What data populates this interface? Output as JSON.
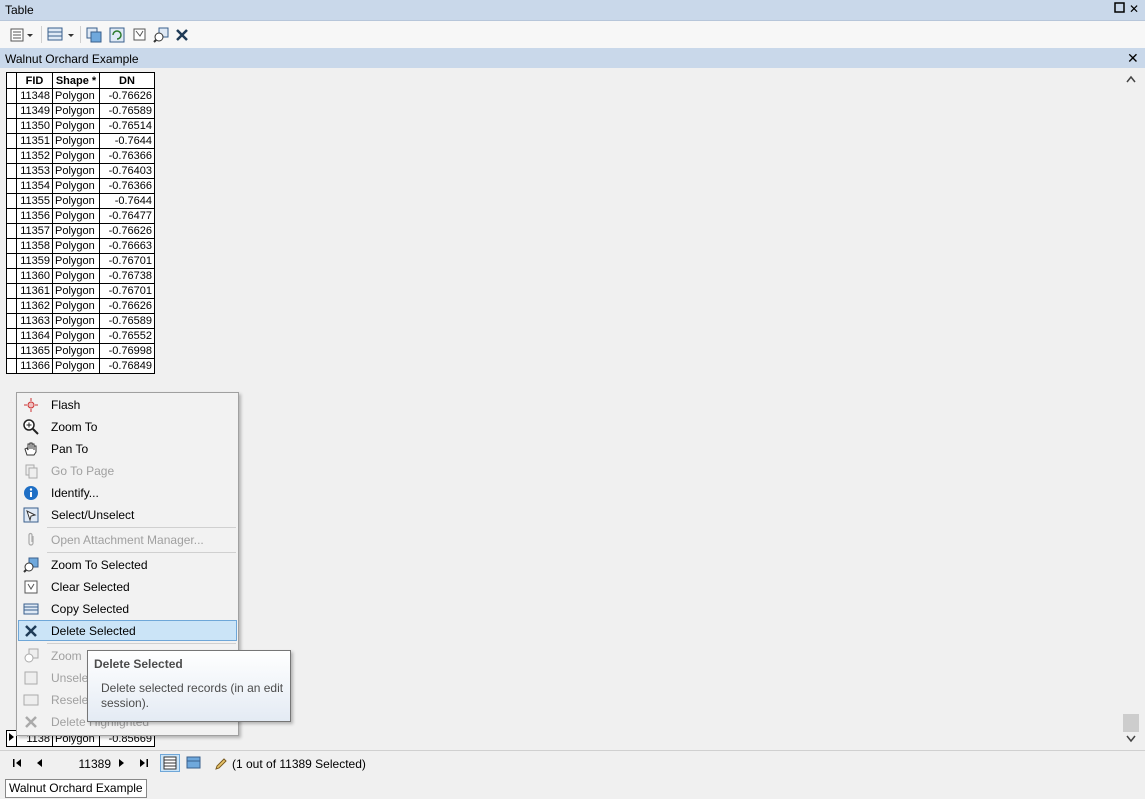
{
  "window": {
    "title": "Table"
  },
  "table_tab": {
    "title": "Walnut Orchard Example"
  },
  "grid": {
    "headers": [
      "FID",
      "Shape *",
      "DN"
    ],
    "rows": [
      [
        "11348",
        "Polygon",
        "-0.76626"
      ],
      [
        "11349",
        "Polygon",
        "-0.76589"
      ],
      [
        "11350",
        "Polygon",
        "-0.76514"
      ],
      [
        "11351",
        "Polygon",
        "-0.7644"
      ],
      [
        "11352",
        "Polygon",
        "-0.76366"
      ],
      [
        "11353",
        "Polygon",
        "-0.76403"
      ],
      [
        "11354",
        "Polygon",
        "-0.76366"
      ],
      [
        "11355",
        "Polygon",
        "-0.7644"
      ],
      [
        "11356",
        "Polygon",
        "-0.76477"
      ],
      [
        "11357",
        "Polygon",
        "-0.76626"
      ],
      [
        "11358",
        "Polygon",
        "-0.76663"
      ],
      [
        "11359",
        "Polygon",
        "-0.76701"
      ],
      [
        "11360",
        "Polygon",
        "-0.76738"
      ],
      [
        "11361",
        "Polygon",
        "-0.76701"
      ],
      [
        "11362",
        "Polygon",
        "-0.76626"
      ],
      [
        "11363",
        "Polygon",
        "-0.76589"
      ],
      [
        "11364",
        "Polygon",
        "-0.76552"
      ],
      [
        "11365",
        "Polygon",
        "-0.76998"
      ],
      [
        "11366",
        "Polygon",
        "-0.76849"
      ]
    ],
    "selected_row": [
      "1138",
      "Polygon",
      "-0.85669"
    ]
  },
  "context_menu": {
    "items": [
      {
        "label": "Flash",
        "icon": "flash-icon",
        "enabled": true
      },
      {
        "label": "Zoom To",
        "icon": "zoom-in-icon",
        "enabled": true
      },
      {
        "label": "Pan To",
        "icon": "hand-icon",
        "enabled": true
      },
      {
        "label": "Go To Page",
        "icon": "page-icon",
        "enabled": false
      },
      {
        "label": "Identify...",
        "icon": "info-icon",
        "enabled": true
      },
      {
        "label": "Select/Unselect",
        "icon": "select-icon",
        "enabled": true
      },
      {
        "label": "Open Attachment Manager...",
        "icon": "paperclip-icon",
        "enabled": false
      },
      {
        "label": "Zoom To Selected",
        "icon": "zoom-selected-icon",
        "enabled": true
      },
      {
        "label": "Clear Selected",
        "icon": "clear-selection-icon",
        "enabled": true
      },
      {
        "label": "Copy Selected",
        "icon": "copy-icon",
        "enabled": true
      },
      {
        "label": "Delete Selected",
        "icon": "delete-icon",
        "enabled": true,
        "highlighted": true
      },
      {
        "label": "Zoom",
        "icon": "zoom-highlighted-icon",
        "enabled": false
      },
      {
        "label": "Unsele",
        "icon": "unselect-icon",
        "enabled": false
      },
      {
        "label": "Resele",
        "icon": "reselect-icon",
        "enabled": false
      },
      {
        "label": "Delete Highlighted",
        "icon": "delete-icon",
        "enabled": false
      }
    ]
  },
  "tooltip": {
    "title": "Delete Selected",
    "body": "Delete selected records (in an edit session)."
  },
  "status_bar": {
    "current_record": "11389",
    "selection_text": "(1 out of 11389 Selected)"
  },
  "bottom_tab": {
    "label": "Walnut Orchard Example"
  },
  "colors": {
    "title_bg": "#c9d8ea",
    "menu_highlight": "#cbe4f7",
    "selected_row": "#87ecec"
  }
}
